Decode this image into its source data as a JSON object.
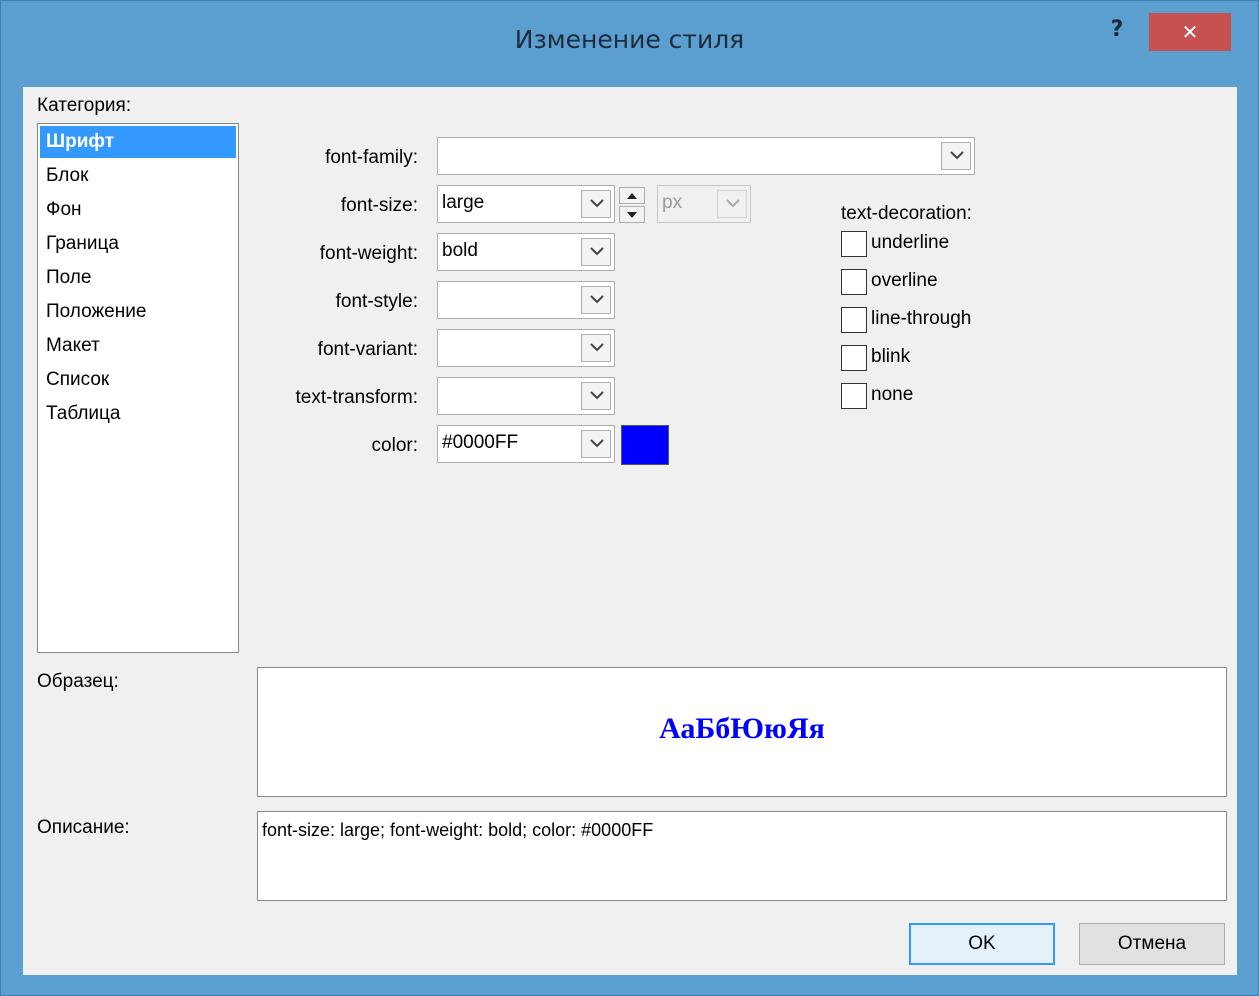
{
  "window": {
    "title": "Изменение стиля",
    "help_label": "?",
    "close_label": "✕"
  },
  "category": {
    "label": "Категория:",
    "items": [
      "Шрифт",
      "Блок",
      "Фон",
      "Граница",
      "Поле",
      "Положение",
      "Макет",
      "Список",
      "Таблица"
    ],
    "selected": "Шрифт"
  },
  "fields": {
    "font_family": {
      "label": "font-family:",
      "value": ""
    },
    "font_size": {
      "label": "font-size:",
      "value": "large",
      "unit": "px"
    },
    "font_weight": {
      "label": "font-weight:",
      "value": "bold"
    },
    "font_style": {
      "label": "font-style:",
      "value": ""
    },
    "font_variant": {
      "label": "font-variant:",
      "value": ""
    },
    "text_transform": {
      "label": "text-transform:",
      "value": ""
    },
    "color": {
      "label": "color:",
      "value": "#0000FF",
      "swatch": "#0000FF"
    }
  },
  "text_decoration": {
    "label": "text-decoration:",
    "options": [
      {
        "label": "underline",
        "checked": false
      },
      {
        "label": "overline",
        "checked": false
      },
      {
        "label": "line-through",
        "checked": false
      },
      {
        "label": "blink",
        "checked": false
      },
      {
        "label": "none",
        "checked": false
      }
    ]
  },
  "sample": {
    "label": "Образец:",
    "text": "АаБбЮюЯя"
  },
  "description": {
    "label": "Описание:",
    "text": "font-size: large; font-weight: bold; color: #0000FF"
  },
  "buttons": {
    "ok": "OK",
    "cancel": "Отмена"
  }
}
